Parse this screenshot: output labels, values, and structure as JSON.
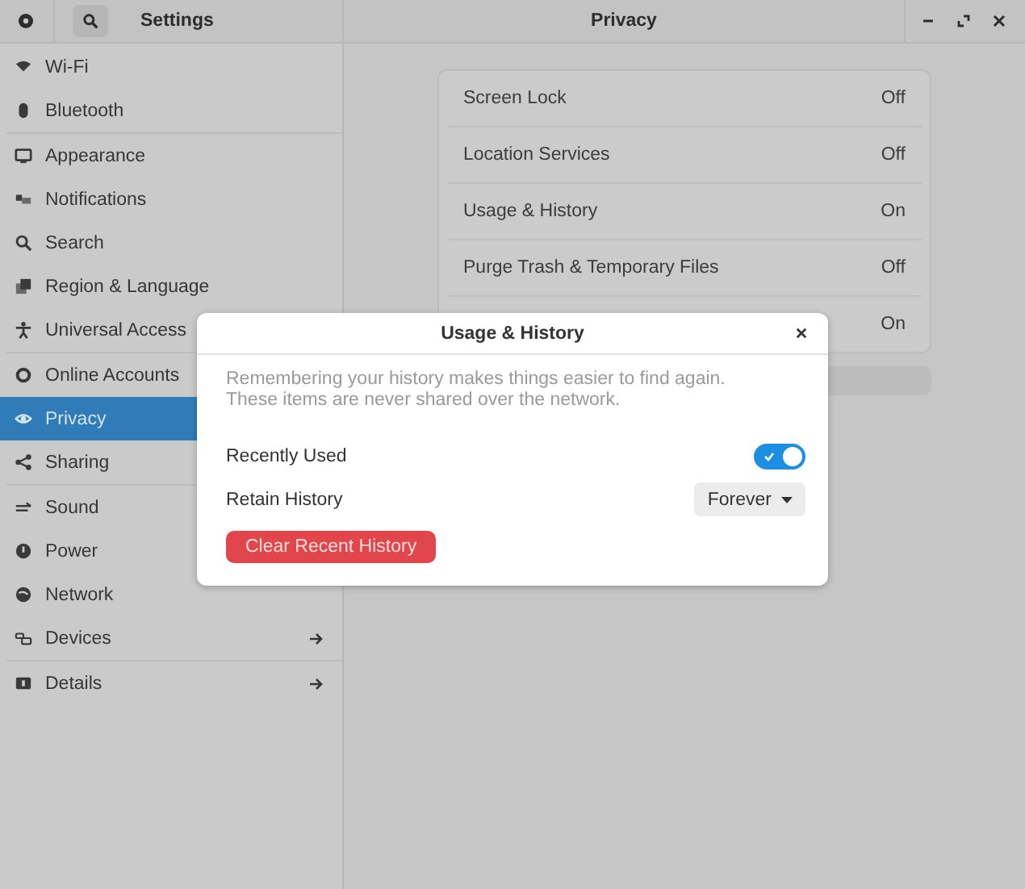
{
  "window": {
    "app_title": "Settings",
    "page_title": "Privacy"
  },
  "sidebar": {
    "groups": [
      [
        {
          "label": "Wi-Fi",
          "kind": "page",
          "selected": false
        },
        {
          "label": "Bluetooth",
          "kind": "page",
          "selected": false
        }
      ],
      [
        {
          "label": "Appearance",
          "kind": "page",
          "selected": false
        },
        {
          "label": "Notifications",
          "kind": "page",
          "selected": false
        },
        {
          "label": "Search",
          "kind": "page",
          "selected": false
        },
        {
          "label": "Region & Language",
          "kind": "page",
          "selected": false
        },
        {
          "label": "Universal Access",
          "kind": "page",
          "selected": false
        }
      ],
      [
        {
          "label": "Online Accounts",
          "kind": "page",
          "selected": false
        },
        {
          "label": "Privacy",
          "kind": "page",
          "selected": true
        },
        {
          "label": "Sharing",
          "kind": "page",
          "selected": false
        }
      ],
      [
        {
          "label": "Sound",
          "kind": "page",
          "selected": false
        },
        {
          "label": "Power",
          "kind": "page",
          "selected": false
        },
        {
          "label": "Network",
          "kind": "page",
          "selected": false
        },
        {
          "label": "Devices",
          "kind": "subpage",
          "selected": false
        }
      ],
      [
        {
          "label": "Details",
          "kind": "subpage",
          "selected": false
        }
      ]
    ]
  },
  "privacy_list": [
    {
      "label": "Screen Lock",
      "value": "Off"
    },
    {
      "label": "Location Services",
      "value": "Off"
    },
    {
      "label": "Usage & History",
      "value": "On"
    },
    {
      "label": "Purge Trash & Temporary Files",
      "value": "Off"
    },
    {
      "value": "On"
    }
  ],
  "dialog": {
    "title": "Usage & History",
    "description": "Remembering your history makes things easier to find again.\nThese items are never shared over the network.",
    "rows": [
      {
        "kind": "switch",
        "label": "Recently Used",
        "on": true
      },
      {
        "kind": "dropdown",
        "label": "Retain History",
        "value": "Forever"
      }
    ],
    "button": "Clear Recent History"
  }
}
